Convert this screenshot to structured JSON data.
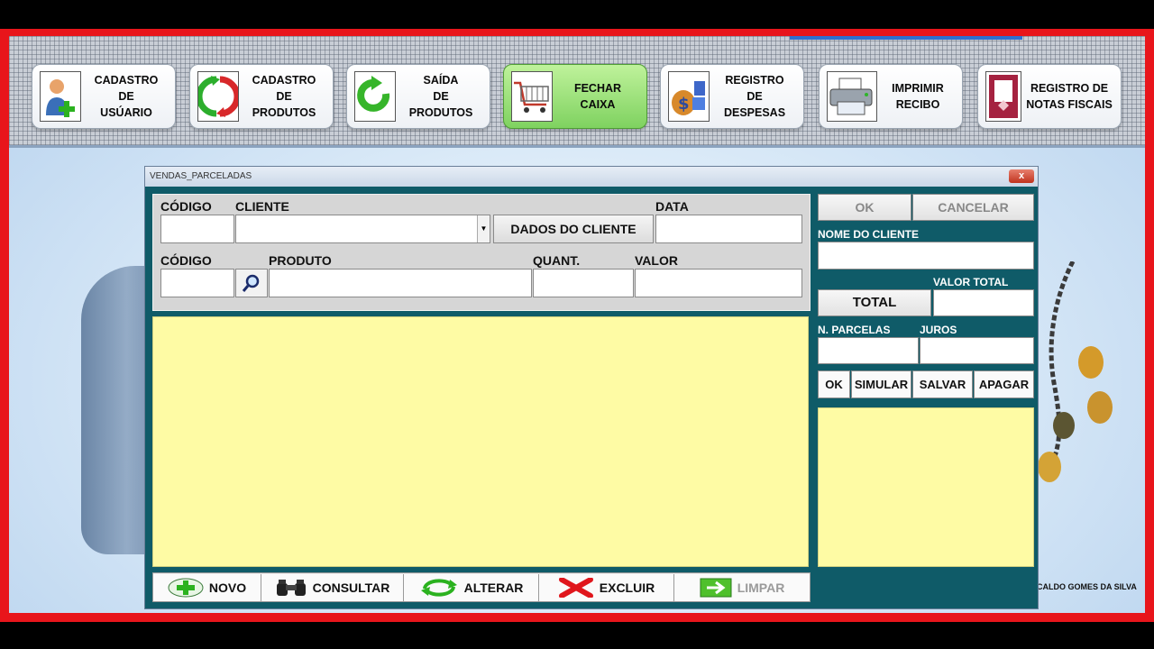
{
  "toolbar": {
    "buttons": [
      {
        "label": "CADASTRO\nDE\nUSÚARIO",
        "icon": "user-add-icon"
      },
      {
        "label": "CADASTRO\nDE\nPRODUTOS",
        "icon": "refresh-arrows-icon"
      },
      {
        "label": "SAÍDA\nDE\nPRODUTOS",
        "icon": "circular-arrow-icon"
      },
      {
        "label": "FECHAR\nCAIXA",
        "icon": "shopping-cart-icon",
        "active": true
      },
      {
        "label": "REGISTRO\nDE\nDESPESAS",
        "icon": "money-bag-icon"
      },
      {
        "label": "IMPRIMIR\nRECIBO",
        "icon": "printer-icon"
      },
      {
        "label": "REGISTRO DE\nNOTAS FISCAIS",
        "icon": "document-icon"
      }
    ]
  },
  "window": {
    "title": "VENDAS_PARCELADAS",
    "close_label": "x"
  },
  "form": {
    "codigo_label": "CÓDIGO",
    "cliente_label": "CLIENTE",
    "data_label": "DATA",
    "dados_cliente_button": "DADOS DO CLIENTE",
    "codigo2_label": "CÓDIGO",
    "produto_label": "PRODUTO",
    "quant_label": "QUANT.",
    "valor_label": "VALOR",
    "codigo_value": "",
    "cliente_value": "",
    "data_value": "",
    "produto_value": "",
    "quant_value": "",
    "valor_value": ""
  },
  "bottom_bar": {
    "novo": "NOVO",
    "consultar": "CONSULTAR",
    "alterar": "ALTERAR",
    "excluir": "EXCLUIR",
    "limpar": "LIMPAR"
  },
  "right_panel": {
    "ok_label": "OK",
    "cancelar_label": "CANCELAR",
    "nome_cliente_label": "NOME DO CLIENTE",
    "valor_total_label": "VALOR TOTAL",
    "total_button": "TOTAL",
    "n_parcelas_label": "N. PARCELAS",
    "juros_label": "JUROS",
    "ok2_label": "OK",
    "simular_label": "SIMULAR",
    "salvar_label": "SALVAR",
    "apagar_label": "APAGAR"
  },
  "credit": "CALDO GOMES DA SILVA",
  "colors": {
    "frame": "#e8151b",
    "window_bg": "#0f5b68",
    "grid_yellow": "#fefba4",
    "active_green": "#7fd260"
  }
}
